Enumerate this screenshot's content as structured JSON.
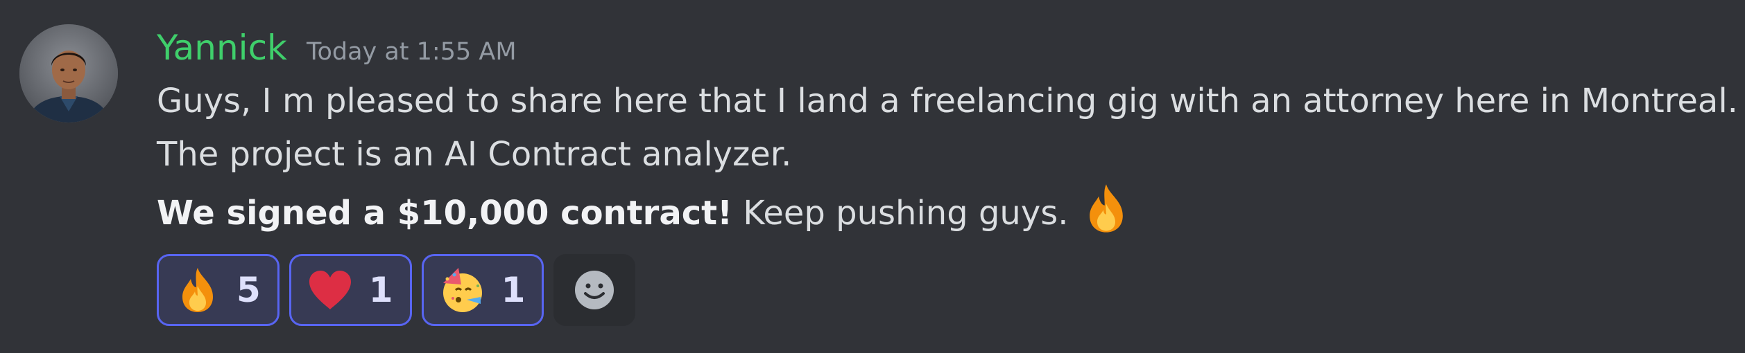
{
  "message": {
    "author": "Yannick",
    "timestamp": "Today at 1:55 AM",
    "line1": "Guys, I m pleased to share here that I land a freelancing gig with an attorney here in Montreal.",
    "line2": "The project is an AI Contract analyzer.",
    "line3_bold": "We signed a $10,000 contract!",
    "line3_rest": " Keep pushing guys.",
    "inline_emoji": "fire-icon"
  },
  "reactions": [
    {
      "emoji": "fire-icon",
      "count": "5"
    },
    {
      "emoji": "red-heart-icon",
      "count": "1"
    },
    {
      "emoji": "partying-face-icon",
      "count": "1"
    }
  ],
  "add_reaction_icon": "add-reaction-smiley-icon",
  "colors": {
    "background": "#313338",
    "username": "#3fcf6b",
    "reaction_border": "#5865f2"
  }
}
